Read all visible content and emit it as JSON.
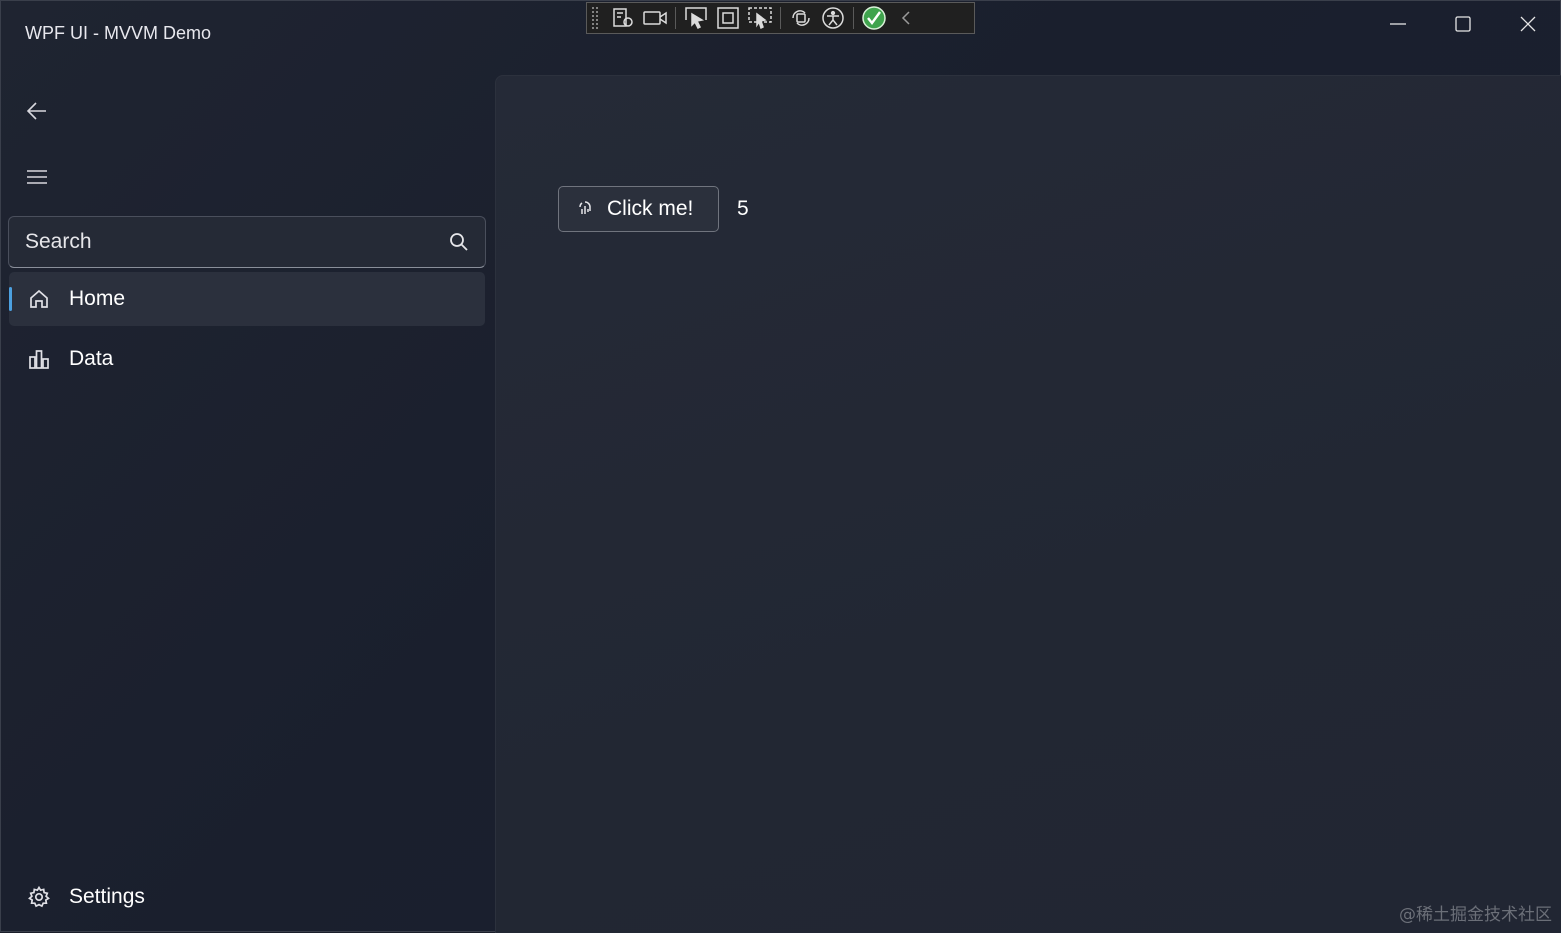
{
  "window": {
    "title": "WPF UI - MVVM Demo"
  },
  "toolbar": {
    "icons": [
      "live-visual-tree-icon",
      "video-icon",
      "select-element-icon",
      "display-layout-adorners-icon",
      "track-focus-icon",
      "hot-reload-icon",
      "accessibility-icon",
      "binding-check-icon",
      "collapse-chevron-icon"
    ]
  },
  "sidebar": {
    "search": {
      "placeholder": "Search"
    },
    "items": [
      {
        "label": "Home",
        "icon": "home-icon",
        "active": true
      },
      {
        "label": "Data",
        "icon": "data-chart-icon",
        "active": false
      }
    ],
    "footer": {
      "label": "Settings",
      "icon": "gear-icon"
    }
  },
  "main": {
    "button_label": "Click me!",
    "counter": "5"
  },
  "watermark": "@稀土掘金技术社区",
  "colors": {
    "accent": "#4ca0e0",
    "background": "#1a1e2a",
    "content": "#232834"
  }
}
